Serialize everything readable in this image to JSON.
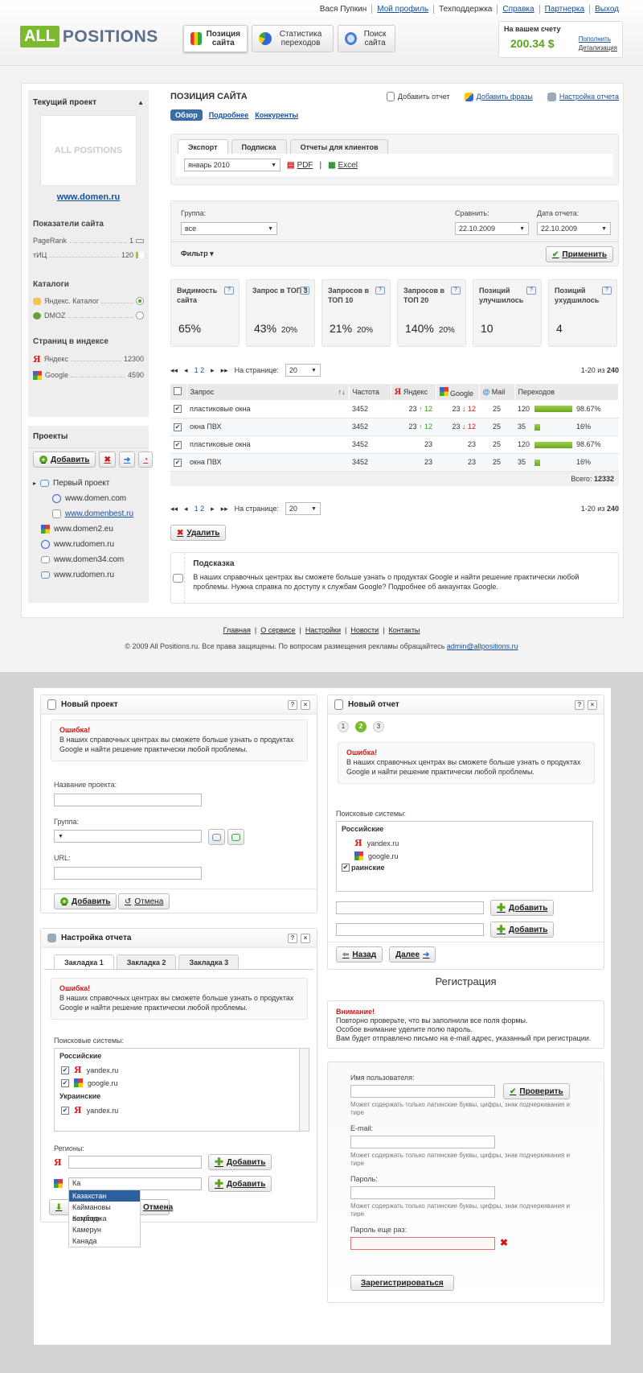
{
  "header": {
    "links": [
      "Вася Пупкин",
      "Мой профиль",
      "Техподдержка",
      "Справка",
      "Партнерка",
      "Выход"
    ],
    "logo_all": "ALL",
    "logo_pos": "POSITIONS",
    "nav": [
      {
        "label": "Позиция сайта"
      },
      {
        "label": "Статистика переходов"
      },
      {
        "label": "Поиск сайта"
      }
    ],
    "balance_title": "На вашем счету",
    "balance_value": "200.34 $",
    "refill": "Пополнить",
    "details": "Детализация"
  },
  "sidebar": {
    "current_project": "Текущий проект",
    "logo_text": "ALL POSITIONS",
    "domain": "www.domen.ru",
    "metrics_title": "Показатели сайта",
    "pagerank_label": "PageRank",
    "pagerank_value": "1",
    "tic_label": "тИЦ",
    "tic_value": "120",
    "catalogs_title": "Каталоги",
    "cat1": "Яндекс. Каталог",
    "cat2": "DMOZ",
    "index_title": "Страниц в индексе",
    "idx1_label": "Яндекс",
    "idx1_value": "12300",
    "idx2_label": "Google",
    "idx2_value": "4590",
    "projects_title": "Проекты",
    "add": "Добавить",
    "tree": [
      "Первый проект",
      "www.domen.com",
      "www.domenbest.ru",
      "www.domen2.eu",
      "www.rudomen.ru",
      "www.domen34.com",
      "www.rudomen.ru"
    ]
  },
  "content": {
    "title": "ПОЗИЦИЯ САЙТА",
    "add_report": "Добавить отчет",
    "add_phrases": "Добавить фразы",
    "report_settings": "Настройка отчета",
    "subtabs": [
      "Обзор",
      "Подробнее",
      "Конкуренты"
    ],
    "export_tabs": [
      "Экспорт",
      "Подписка",
      "Отчеты для клиентов"
    ],
    "month": "январь 2010",
    "pdf": "PDF",
    "excel": "Excel",
    "group_label": "Группа:",
    "group_value": "все",
    "compare_label": "Сравнить:",
    "compare_value": "22.10.2009",
    "date_label": "Дата отчета:",
    "date_value": "22.10.2009",
    "filter": "Фильтр",
    "apply": "Применить",
    "cards": [
      {
        "t": "Видимость сайта",
        "v": "65%",
        "s": ""
      },
      {
        "t": "Запрос в ТОП 3",
        "v": "43%",
        "s": "20%"
      },
      {
        "t": "Запросов в ТОП 10",
        "v": "21%",
        "s": "20%"
      },
      {
        "t": "Запросов в ТОП 20",
        "v": "140%",
        "s": "20%"
      },
      {
        "t": "Позиций улучшилось",
        "v": "10",
        "s": ""
      },
      {
        "t": "Позиций ухудшилось",
        "v": "4",
        "s": ""
      }
    ],
    "pager": {
      "pages": "1 2",
      "per_page": "На странице:",
      "per_value": "20",
      "range": "1-20 из",
      "total": "240"
    },
    "columns": [
      "Запрос",
      "Частота",
      "Яндекс",
      "Google",
      "Mail",
      "Переходов"
    ],
    "rows": [
      {
        "q": "пластиковые окна",
        "f": "3452",
        "y": "23",
        "yd": "↑ 12",
        "g": "23",
        "gd": "↓ 12",
        "m": "25",
        "p": "120",
        "pct": "98.67%",
        "frac": 0.99
      },
      {
        "q": "окна ПВХ",
        "f": "3452",
        "y": "23",
        "yd": "↑ 12",
        "g": "23",
        "gd": "↓ 12",
        "m": "25",
        "p": "35",
        "pct": "16%",
        "frac": 0.16
      },
      {
        "q": "пластиковые окна",
        "f": "3452",
        "y": "23",
        "yd": "",
        "g": "23",
        "gd": "",
        "m": "25",
        "p": "120",
        "pct": "98.67%",
        "frac": 0.99
      },
      {
        "q": "окна ПВХ",
        "f": "3452",
        "y": "23",
        "yd": "",
        "g": "23",
        "gd": "",
        "m": "25",
        "p": "35",
        "pct": "16%",
        "frac": 0.16
      }
    ],
    "total_label": "Всего:",
    "total_value": "12332",
    "delete": "Удалить",
    "tip_title": "Подсказка",
    "tip_text": "В наших справочных центрах вы сможете больше узнать о продуктах Google и найти решение практически любой проблемы. Нужна справка по доступу к службам Google? Подробнее об аккаунтах Google."
  },
  "footer": {
    "links": [
      "Главная",
      "О сервисе",
      "Настройки",
      "Новости",
      "Контакты"
    ],
    "copyright": "© 2009 All Positions.ru. Все права защищены. По вопросам размещения рекламы обращайтесь",
    "email": "admin@allpositions.ru"
  },
  "new_project": {
    "title": "Новый проект",
    "err_title": "Ошибка!",
    "err_text": "В наших справочных центрах вы сможете больше узнать о продуктах Google и найти решение практически любой проблемы.",
    "name": "Название проекта:",
    "group": "Группа:",
    "url": "URL:",
    "add": "Добавить",
    "cancel": "Отмена"
  },
  "report_settings": {
    "title": "Настройка отчета",
    "tabs": [
      "Закладка 1",
      "Закладка 2",
      "Закладка 3"
    ],
    "err_title": "Ошибка!",
    "err_text": "В наших справочных центрах вы сможете больше узнать о продуктах Google и найти решение практически любой проблемы.",
    "engines": "Поисковые системы:",
    "ru": "Российские",
    "ua": "Украинские",
    "yandex": "yandex.ru",
    "google": "google.ru",
    "regions": "Регионы:",
    "add": "Добавить",
    "input": "Ка",
    "cancel": "Отмена",
    "dropdown": [
      "Казахстан",
      "Каймановы острова",
      "Камбоджа",
      "Камерун",
      "Канада"
    ]
  },
  "new_report": {
    "title": "Новый отчет",
    "steps": [
      "1",
      "2",
      "3"
    ],
    "err_title": "Ошибка!",
    "err_text": "В наших справочных центрах вы сможете больше узнать о продуктах Google и найти решение практически любой проблемы.",
    "engines": "Поисковые системы:",
    "ru": "Российские",
    "yandex": "yandex.ru",
    "google": "google.ru",
    "ua": "раинские",
    "add": "Добавить",
    "back": "Назад",
    "next": "Далее"
  },
  "registration": {
    "title": "Регистрация",
    "warn_title": "Внимание!",
    "warn_lines": [
      "Повторно проверьте, что вы заполнили все поля формы.",
      "Особое внимание уделите полю пароль.",
      "Вам будет отправлено письмо на e-mail адрес, указанный при регистрации."
    ],
    "user": "Имя пользователя:",
    "check": "Проверить",
    "hint": "Может содержать только латинские буквы, цифры, знак подчеркивания и тире",
    "email": "E-mail:",
    "pass": "Пароль:",
    "pass2": "Пароль еще раз:",
    "submit": "Зарегистрироваться"
  }
}
